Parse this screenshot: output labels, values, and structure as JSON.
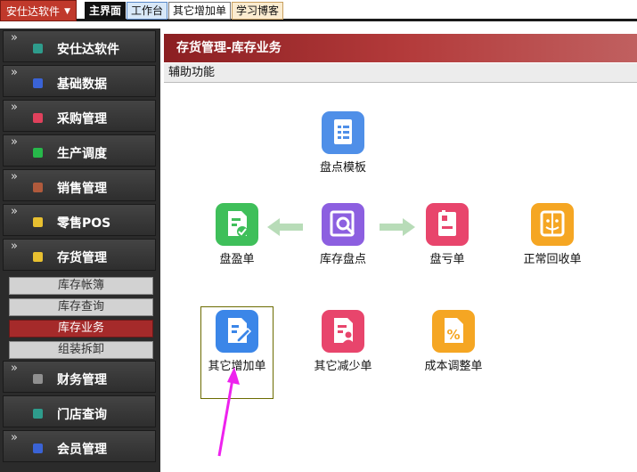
{
  "app_menu": {
    "label": "安仕达软件"
  },
  "tabs": [
    {
      "label": "主界面"
    },
    {
      "label": "工作台"
    },
    {
      "label": "其它增加单"
    },
    {
      "label": "学习博客"
    }
  ],
  "sidebar": {
    "items": [
      {
        "label": "安仕达软件",
        "icon": "teal-square-icon",
        "color": "#2e9c8c"
      },
      {
        "label": "基础数据",
        "icon": "blue-square-icon",
        "color": "#3a63d6"
      },
      {
        "label": "采购管理",
        "icon": "red-square-icon",
        "color": "#e0415c"
      },
      {
        "label": "生产调度",
        "icon": "green-square-icon",
        "color": "#27b84a"
      },
      {
        "label": "销售管理",
        "icon": "brown-square-icon",
        "color": "#b05a3c"
      },
      {
        "label": "零售POS",
        "icon": "yellow-square-icon",
        "color": "#e8c030"
      },
      {
        "label": "存货管理",
        "icon": "yellow-square-icon",
        "color": "#e8c030"
      },
      {
        "label": "财务管理",
        "icon": "gray-square-icon",
        "color": "#909090"
      },
      {
        "label": "门店查询",
        "icon": "teal-square-icon",
        "color": "#2e9c8c"
      },
      {
        "label": "会员管理",
        "icon": "blue-square-icon",
        "color": "#3a63d6"
      }
    ],
    "sub_items": [
      {
        "label": "库存帐簿"
      },
      {
        "label": "库存查询"
      },
      {
        "label": "库存业务",
        "active": true
      },
      {
        "label": "组装拆卸"
      }
    ]
  },
  "panel": {
    "title": "存货管理-库存业务",
    "subtitle": "辅助功能"
  },
  "tiles": [
    {
      "label": "盘点模板",
      "icon": "document-list-icon",
      "color": "#4f8fe8"
    },
    {
      "label": "盘盈单",
      "icon": "document-plus-icon",
      "color": "#3fbf5a"
    },
    {
      "label": "库存盘点",
      "icon": "magnifier-icon",
      "color": "#8c5fe0"
    },
    {
      "label": "盘亏单",
      "icon": "clipboard-minus-icon",
      "color": "#e8456c"
    },
    {
      "label": "正常回收单",
      "icon": "recycle-face-icon",
      "color": "#f5a623"
    },
    {
      "label": "其它增加单",
      "icon": "edit-document-icon",
      "color": "#3b86e8"
    },
    {
      "label": "其它减少单",
      "icon": "document-user-icon",
      "color": "#e8456c"
    },
    {
      "label": "成本调整单",
      "icon": "percent-document-icon",
      "color": "#f5a623"
    }
  ],
  "colors": {
    "accent_red": "#a52a2a",
    "arrow_green": "#b8dcb8",
    "annotation_magenta": "#ee22ee"
  }
}
